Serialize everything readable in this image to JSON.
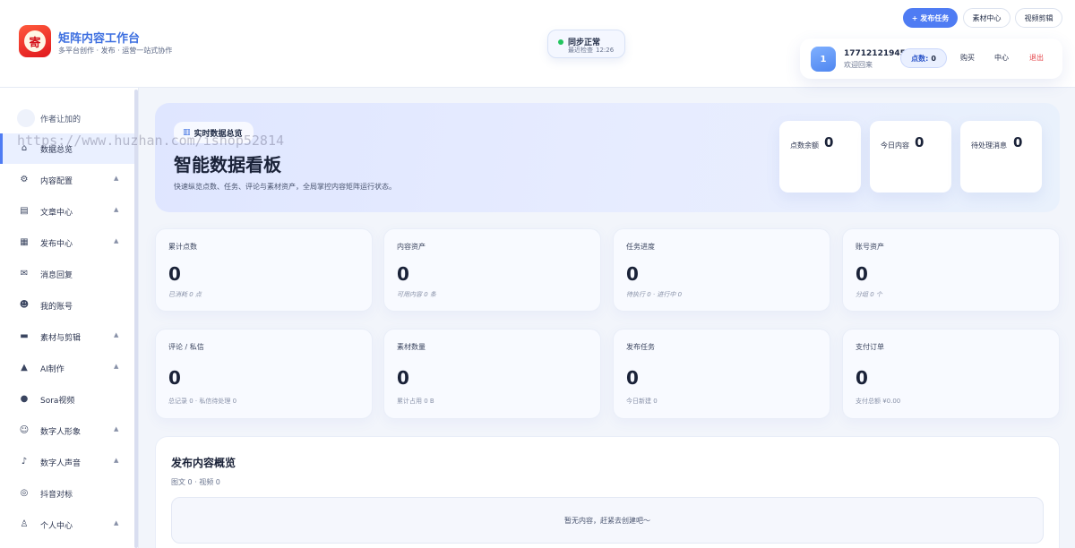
{
  "header": {
    "logo_char": "寄",
    "title": "矩阵内容工作台",
    "subtitle": "多平台创作 · 发布 · 运营一站式协作",
    "sync": {
      "status": "同步正常",
      "label": "最近检查",
      "time": "12:26"
    },
    "buttons": {
      "publish": "+ 发布任务",
      "materials": "素材中心",
      "video_edit": "视频剪辑"
    },
    "user": {
      "avatar_text": "1",
      "phone": "17712121945",
      "welcome": "欢迎回来",
      "points_label": "点数:",
      "points_value": "0",
      "buy": "购买",
      "center": "中心",
      "logout": "退出"
    }
  },
  "sidebar": {
    "author": "作者让加的",
    "items": [
      {
        "label": "数据总览",
        "icon": "home-icon",
        "glyph": "⌂",
        "chevron": false,
        "active": true
      },
      {
        "label": "内容配置",
        "icon": "gear-icon",
        "glyph": "⚙",
        "chevron": true
      },
      {
        "label": "文章中心",
        "icon": "document-icon",
        "glyph": "▤",
        "chevron": true
      },
      {
        "label": "发布中心",
        "icon": "box-icon",
        "glyph": "▦",
        "chevron": true
      },
      {
        "label": "消息回复",
        "icon": "chat-icon",
        "glyph": "✉",
        "chevron": false
      },
      {
        "label": "我的账号",
        "icon": "user-icon",
        "glyph": "☻",
        "chevron": false
      },
      {
        "label": "素材与剪辑",
        "icon": "film-icon",
        "glyph": "▬",
        "chevron": true
      },
      {
        "label": "AI制作",
        "icon": "ai-icon",
        "glyph": "▲",
        "chevron": true
      },
      {
        "label": "Sora视频",
        "icon": "sora-icon",
        "glyph": "●",
        "chevron": false
      },
      {
        "label": "数字人形象",
        "icon": "avatar-icon",
        "glyph": "☺",
        "chevron": true
      },
      {
        "label": "数字人声音",
        "icon": "voice-icon",
        "glyph": "♪",
        "chevron": true
      },
      {
        "label": "抖音对标",
        "icon": "target-icon",
        "glyph": "◎",
        "chevron": false
      },
      {
        "label": "个人中心",
        "icon": "person-icon",
        "glyph": "♙",
        "chevron": true
      }
    ],
    "chevron_glyph": "▲"
  },
  "watermark": "https://www.huzhan.com/ishop52814",
  "hero": {
    "pill": "实时数据总览",
    "title": "智能数据看板",
    "desc": "快速纵览点数、任务、评论与素材资产，全局掌控内容矩阵运行状态。",
    "cards": [
      {
        "label": "点数余额",
        "value": "0"
      },
      {
        "label": "今日内容",
        "value": "0"
      },
      {
        "label": "待处理消息",
        "value": "0"
      }
    ]
  },
  "stats": [
    {
      "label": "累计点数",
      "value": "0",
      "note": "已消耗 0 点",
      "italic": true
    },
    {
      "label": "内容资产",
      "value": "0",
      "note": "可用内容 0 条",
      "italic": true
    },
    {
      "label": "任务进度",
      "value": "0",
      "note": "待执行 0 · 进行中 0",
      "italic": true
    },
    {
      "label": "账号资产",
      "value": "0",
      "note": "分组 0 个",
      "italic": true
    },
    {
      "label": "评论 / 私信",
      "value": "0",
      "note": "总记录 0 · 私信待处理 0",
      "italic": false
    },
    {
      "label": "素材数量",
      "value": "0",
      "note": "累计占用 0 B",
      "italic": false
    },
    {
      "label": "发布任务",
      "value": "0",
      "note": "今日新建 0",
      "italic": false
    },
    {
      "label": "支付订单",
      "value": "0",
      "note": "支付总额 ¥0.00",
      "italic": false
    }
  ],
  "overview": {
    "title": "发布内容概览",
    "sub": "图文 0 · 视频 0",
    "empty": "暂无内容，赶紧去创建吧～"
  }
}
